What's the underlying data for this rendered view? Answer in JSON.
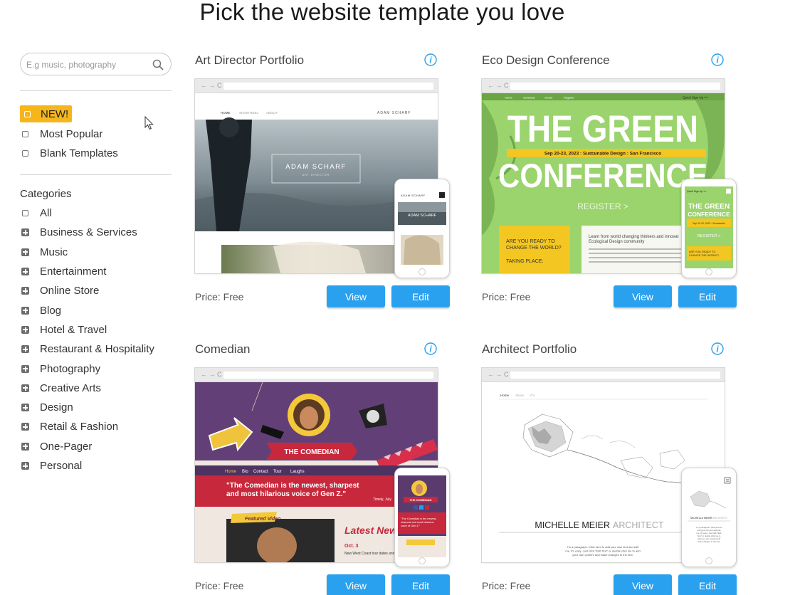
{
  "page": {
    "title": "Pick the website template you love"
  },
  "search": {
    "placeholder": "E.g music, photography"
  },
  "filters": [
    {
      "label": "NEW!",
      "active": true
    },
    {
      "label": "Most Popular"
    },
    {
      "label": "Blank Templates"
    }
  ],
  "categories": {
    "title": "Categories",
    "items": [
      {
        "label": "All",
        "expandable": false
      },
      {
        "label": "Business & Services",
        "expandable": true
      },
      {
        "label": "Music",
        "expandable": true
      },
      {
        "label": "Entertainment",
        "expandable": true
      },
      {
        "label": "Online Store",
        "expandable": true
      },
      {
        "label": "Blog",
        "expandable": true
      },
      {
        "label": "Hotel & Travel",
        "expandable": true
      },
      {
        "label": "Restaurant & Hospitality",
        "expandable": true
      },
      {
        "label": "Photography",
        "expandable": true
      },
      {
        "label": "Creative Arts",
        "expandable": true
      },
      {
        "label": "Design",
        "expandable": true
      },
      {
        "label": "Retail & Fashion",
        "expandable": true
      },
      {
        "label": "One-Pager",
        "expandable": true
      },
      {
        "label": "Personal",
        "expandable": true
      }
    ]
  },
  "templates": [
    {
      "name": "Art Director Portfolio",
      "price": "Price: Free",
      "view_label": "View",
      "edit_label": "Edit",
      "preview": {
        "nav": [
          "HOME",
          "SHOW REEL",
          "ABOUT"
        ],
        "brand": "ADAM SCHARF",
        "hero_name": "ADAM SCHARF",
        "hero_role": "ART DIRECTOR"
      }
    },
    {
      "name": "Eco Design Conference",
      "price": "Price: Free",
      "view_label": "View",
      "edit_label": "Edit",
      "preview": {
        "nav": [
          "Home",
          "Schedule",
          "Venue",
          "Register"
        ],
        "signup": "Quick Sign Up >>",
        "headline_1": "THE GREEN",
        "headline_2": "CONFERENCE",
        "dates": "Sep 20-23, 2023 : Sustainable Design : San Francisco",
        "cta": "REGISTER >",
        "ready": "ARE YOU READY TO CHANGE THE WORLD?",
        "taking_place": "TAKING PLACE:",
        "learn": "Learn from world changing thinkers and innovators Ecological Design community"
      }
    },
    {
      "name": "Comedian",
      "price": "Price: Free",
      "view_label": "View",
      "edit_label": "Edit",
      "preview": {
        "banner": "THE COMEDIAN",
        "nav": [
          "Home",
          "Bio",
          "Contact",
          "Tour",
          "Laughs"
        ],
        "tagline": "\"The Comedian is the newest, sharpest and most hilarious voice of Gen Z.\"",
        "quote_source": "Timely, July",
        "featured": "Featured Video",
        "latest": "Latest News",
        "news_date": "Oct. 3",
        "news_text": "New West Coast tour dates announced"
      }
    },
    {
      "name": "Architect Portfolio",
      "price": "Price: Free",
      "view_label": "View",
      "edit_label": "Edit",
      "preview": {
        "nav": [
          "Home",
          "About",
          "CV"
        ],
        "name_dark": "MICHELLE MEIER",
        "name_light": "ARCHITECT",
        "para": "I'm a paragraph. Click here to add your own text and edit me. It's easy. Just click \"Edit Text\" or double click me to add your own content and make changes to the font."
      }
    }
  ],
  "colors": {
    "accent": "#2aa1ef",
    "new_badge": "#f7b51c",
    "eco_green": "#9bd36d"
  }
}
